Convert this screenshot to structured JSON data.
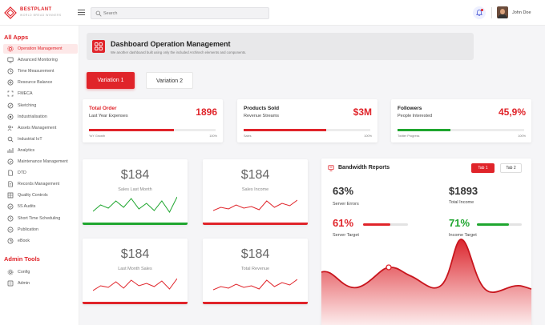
{
  "header": {
    "brand": "BESTPLANT",
    "brand_tagline": "WORLD BREAD WINNERS",
    "search_placeholder": "Search",
    "user_name": "John Doe"
  },
  "sidebar": {
    "section1_title": "All Apps",
    "section1_items": [
      {
        "label": "Operation Management",
        "active": true,
        "icon": "gear-icon"
      },
      {
        "label": "Advanced Monitoring",
        "icon": "monitor-icon"
      },
      {
        "label": "Time Measurement",
        "icon": "clock-icon"
      },
      {
        "label": "Resource Balance",
        "icon": "balance-icon"
      },
      {
        "label": "FMECA",
        "icon": "grid-icon"
      },
      {
        "label": "Sketching",
        "icon": "pencil-icon"
      },
      {
        "label": "Industrialisation",
        "icon": "factory-icon"
      },
      {
        "label": "Assets Management",
        "icon": "assets-icon"
      },
      {
        "label": "Industrial IoT",
        "icon": "iot-icon"
      },
      {
        "label": "Analytics",
        "icon": "analytics-icon"
      },
      {
        "label": "Maintenance Management",
        "icon": "wrench-icon"
      },
      {
        "label": "DTD",
        "icon": "document-icon"
      },
      {
        "label": "Records Management",
        "icon": "records-icon"
      },
      {
        "label": "Quality Controls",
        "icon": "quality-icon"
      },
      {
        "label": "5S Audits",
        "icon": "audit-icon"
      },
      {
        "label": "Short Time Scheduling",
        "icon": "schedule-icon"
      },
      {
        "label": "Publication",
        "icon": "publication-icon"
      },
      {
        "label": "eBook",
        "icon": "ebook-icon"
      }
    ],
    "section2_title": "Admin Tools",
    "section2_items": [
      {
        "label": "Config",
        "icon": "config-icon"
      },
      {
        "label": "Admin",
        "icon": "admin-icon"
      }
    ]
  },
  "page": {
    "title": "Dashboard Operation Management",
    "subtitle": "We another dashboard built using only the included Architech elements and components.",
    "variation1": "Variation 1",
    "variation2": "Variation 2"
  },
  "stats": [
    {
      "title": "Total Order",
      "subtitle": "Last Year Expenses",
      "value": "1896",
      "footer": "YoY Growth",
      "percent": "100%",
      "progress": 0.67,
      "bar_color": "#e0242a",
      "title_red": true
    },
    {
      "title": "Products Sold",
      "subtitle": "Revenue Streams",
      "value": "$3M",
      "footer": "Sales",
      "percent": "100%",
      "progress": 0.65,
      "bar_color": "#e0242a",
      "title_red": false
    },
    {
      "title": "Followers",
      "subtitle": "People Interested",
      "value": "45,9%",
      "footer": "Twitter Progress",
      "percent": "100%",
      "progress": 0.42,
      "bar_color": "#1fa62f",
      "title_red": false
    }
  ],
  "mini_cards": [
    {
      "value": "$184",
      "label": "Sales Last Month",
      "line_color": "#1fa62f",
      "bottom_color": "#1fa62f",
      "points": [
        22,
        14,
        18,
        9,
        17,
        6,
        19,
        12,
        21,
        9,
        23,
        4
      ]
    },
    {
      "value": "$184",
      "label": "Sales Income",
      "line_color": "#e0242a",
      "bottom_color": "#e0242a",
      "points": [
        21,
        17,
        19,
        14,
        18,
        16,
        20,
        9,
        17,
        12,
        15,
        8
      ]
    },
    {
      "value": "$184",
      "label": "Last Month Sales",
      "line_color": "#e0242a",
      "bottom_color": "#e0242a",
      "points": [
        22,
        16,
        18,
        11,
        19,
        9,
        16,
        13,
        17,
        10,
        20,
        7
      ]
    },
    {
      "value": "$184",
      "label": "Total Revenue",
      "line_color": "#e0242a",
      "bottom_color": "#e0242a",
      "points": [
        21,
        17,
        19,
        14,
        18,
        16,
        20,
        9,
        17,
        12,
        15,
        8
      ]
    }
  ],
  "bandwidth": {
    "title": "Bandwidth Reports",
    "tab1": "Tab 1",
    "tab2": "Tab 2",
    "stat1_value": "63%",
    "stat1_label": "Server Errors",
    "stat2_value": "$1893",
    "stat2_label": "Total Income",
    "stat3_value": "61%",
    "stat3_label": "Server Target",
    "stat3_progress": 0.61,
    "stat3_color": "#e0242a",
    "stat4_value": "71%",
    "stat4_label": "Income Target",
    "stat4_progress": 0.71,
    "stat4_color": "#1fa62f"
  }
}
